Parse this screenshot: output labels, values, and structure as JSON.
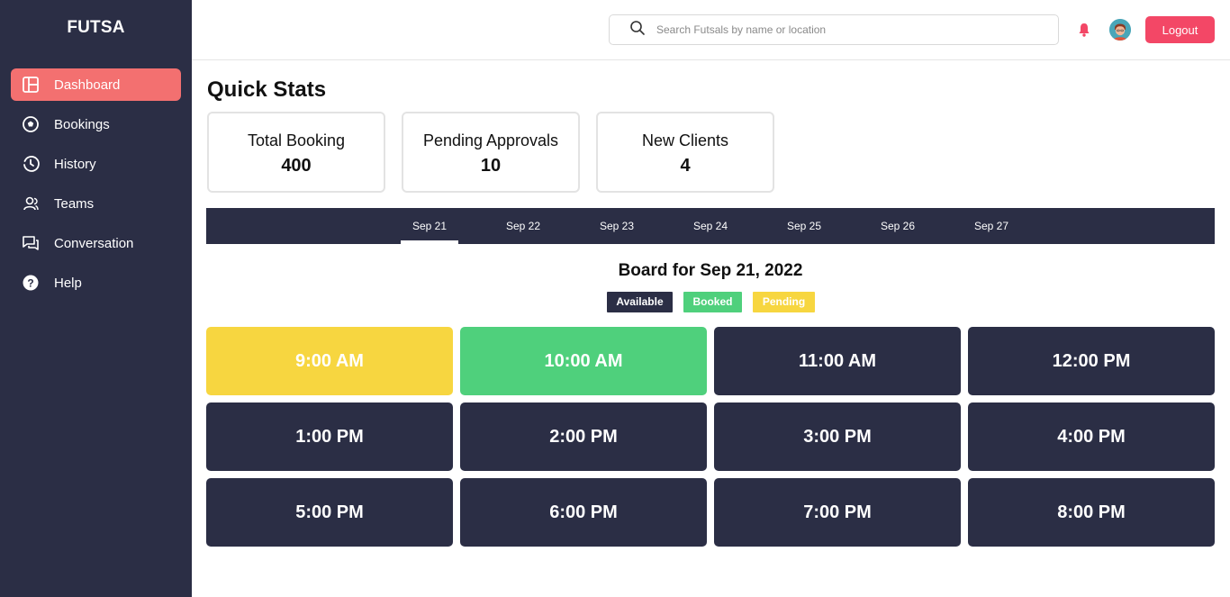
{
  "app": {
    "brand": "FUTSA"
  },
  "sidebar": {
    "items": [
      {
        "label": "Dashboard",
        "icon": "dashboard-icon",
        "active": true
      },
      {
        "label": "Bookings",
        "icon": "soccer-ball-icon",
        "active": false
      },
      {
        "label": "History",
        "icon": "history-icon",
        "active": false
      },
      {
        "label": "Teams",
        "icon": "teams-icon",
        "active": false
      },
      {
        "label": "Conversation",
        "icon": "conversation-icon",
        "active": false
      },
      {
        "label": "Help",
        "icon": "help-icon",
        "active": false
      }
    ]
  },
  "header": {
    "search": {
      "placeholder": "Search Futsals by name or location",
      "value": ""
    },
    "logout_label": "Logout"
  },
  "quick_stats": {
    "title": "Quick Stats",
    "cards": [
      {
        "label": "Total Booking",
        "value": "400"
      },
      {
        "label": "Pending Approvals",
        "value": "10"
      },
      {
        "label": "New Clients",
        "value": "4"
      }
    ]
  },
  "dates": {
    "tabs": [
      "Sep 21",
      "Sep 22",
      "Sep 23",
      "Sep 24",
      "Sep 25",
      "Sep 26",
      "Sep 27"
    ],
    "active_index": 0
  },
  "board": {
    "title": "Board for Sep 21, 2022",
    "legend": [
      {
        "label": "Available",
        "color": "#2b2e45"
      },
      {
        "label": "Booked",
        "color": "#4fd07c"
      },
      {
        "label": "Pending",
        "color": "#f7d640"
      }
    ],
    "slots": [
      {
        "time": "9:00 AM",
        "status": "pending"
      },
      {
        "time": "10:00 AM",
        "status": "booked"
      },
      {
        "time": "11:00 AM",
        "status": "available"
      },
      {
        "time": "12:00 PM",
        "status": "available"
      },
      {
        "time": "1:00 PM",
        "status": "available"
      },
      {
        "time": "2:00 PM",
        "status": "available"
      },
      {
        "time": "3:00 PM",
        "status": "available"
      },
      {
        "time": "4:00 PM",
        "status": "available"
      },
      {
        "time": "5:00 PM",
        "status": "available"
      },
      {
        "time": "6:00 PM",
        "status": "available"
      },
      {
        "time": "7:00 PM",
        "status": "available"
      },
      {
        "time": "8:00 PM",
        "status": "available"
      }
    ]
  },
  "colors": {
    "sidebar_bg": "#2b2e45",
    "active_nav": "#f37070",
    "logout": "#f34766",
    "booked": "#4fd07c",
    "pending": "#f7d640",
    "available": "#2b2e45"
  }
}
